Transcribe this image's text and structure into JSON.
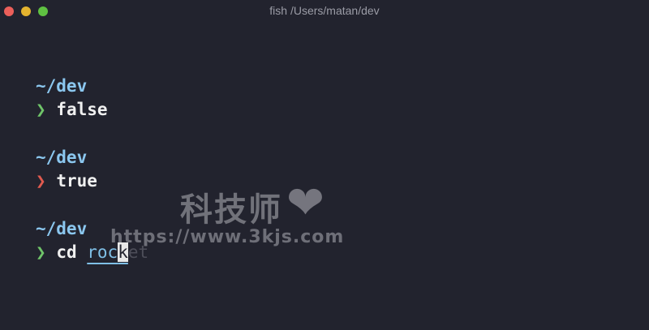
{
  "window": {
    "title": "fish /Users/matan/dev",
    "buttons": {
      "close_color": "#ec5f5a",
      "minimize_color": "#e4b32f",
      "maximize_color": "#5fc142"
    }
  },
  "terminal": {
    "blocks": [
      {
        "cwd": "~/dev",
        "prompt": "❯",
        "status": "success",
        "command": "false"
      },
      {
        "cwd": "~/dev",
        "prompt": "❯",
        "status": "error",
        "command": "true"
      },
      {
        "cwd": "~/dev",
        "prompt": "❯",
        "status": "success",
        "command": "cd",
        "argument_typed": "roc",
        "cursor_char": "k",
        "autosuggestion": "et"
      }
    ]
  },
  "watermark": {
    "text": "科技师",
    "icon": "heart-icon",
    "url": "https://www.3kjs.com"
  }
}
